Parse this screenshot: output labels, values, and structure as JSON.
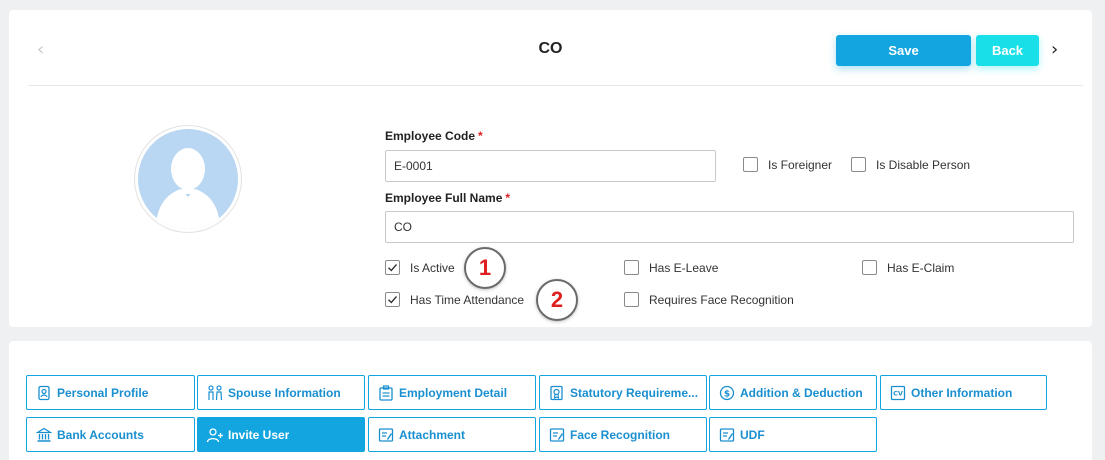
{
  "header": {
    "title": "CO",
    "save_label": "Save",
    "back_label": "Back",
    "prev_icon": "chevron-left-icon",
    "next_icon": "chevron-right-icon"
  },
  "form": {
    "employee_code_label": "Employee Code",
    "employee_code_value": "E-0001",
    "employee_full_name_label": "Employee Full Name",
    "employee_full_name_value": "CO",
    "required_mark": "*",
    "checkboxes": {
      "is_foreigner": {
        "label": "Is Foreigner",
        "checked": false
      },
      "is_disable_person": {
        "label": "Is Disable Person",
        "checked": false
      },
      "is_active": {
        "label": "Is Active",
        "checked": true
      },
      "has_e_leave": {
        "label": "Has E-Leave",
        "checked": false
      },
      "has_e_claim": {
        "label": "Has E-Claim",
        "checked": false
      },
      "has_time_attendance": {
        "label": "Has Time Attendance",
        "checked": true
      },
      "requires_face_recognition": {
        "label": "Requires Face Recognition",
        "checked": false
      }
    }
  },
  "annotations": [
    "1",
    "2"
  ],
  "tabs": [
    {
      "label": "Personal Profile",
      "icon": "profile-icon",
      "active": false
    },
    {
      "label": "Spouse Information",
      "icon": "couple-icon",
      "active": false
    },
    {
      "label": "Employment Detail",
      "icon": "briefcase-icon",
      "active": false
    },
    {
      "label": "Statutory Requireme...",
      "icon": "certificate-icon",
      "active": false
    },
    {
      "label": "Addition & Deduction",
      "icon": "money-icon",
      "active": false
    },
    {
      "label": "Other Information",
      "icon": "cv-icon",
      "active": false
    },
    {
      "label": "Bank Accounts",
      "icon": "bank-icon",
      "active": false
    },
    {
      "label": "Invite User",
      "icon": "add-user-icon",
      "active": true
    },
    {
      "label": "Attachment",
      "icon": "attachment-icon",
      "active": false
    },
    {
      "label": "Face Recognition",
      "icon": "face-recognition-icon",
      "active": false
    },
    {
      "label": "UDF",
      "icon": "udf-icon",
      "active": false
    }
  ],
  "colors": {
    "primary": "#13a5e0",
    "back_button": "#19e0e8",
    "required": "#e02020",
    "avatar": "#b9d6f2"
  }
}
